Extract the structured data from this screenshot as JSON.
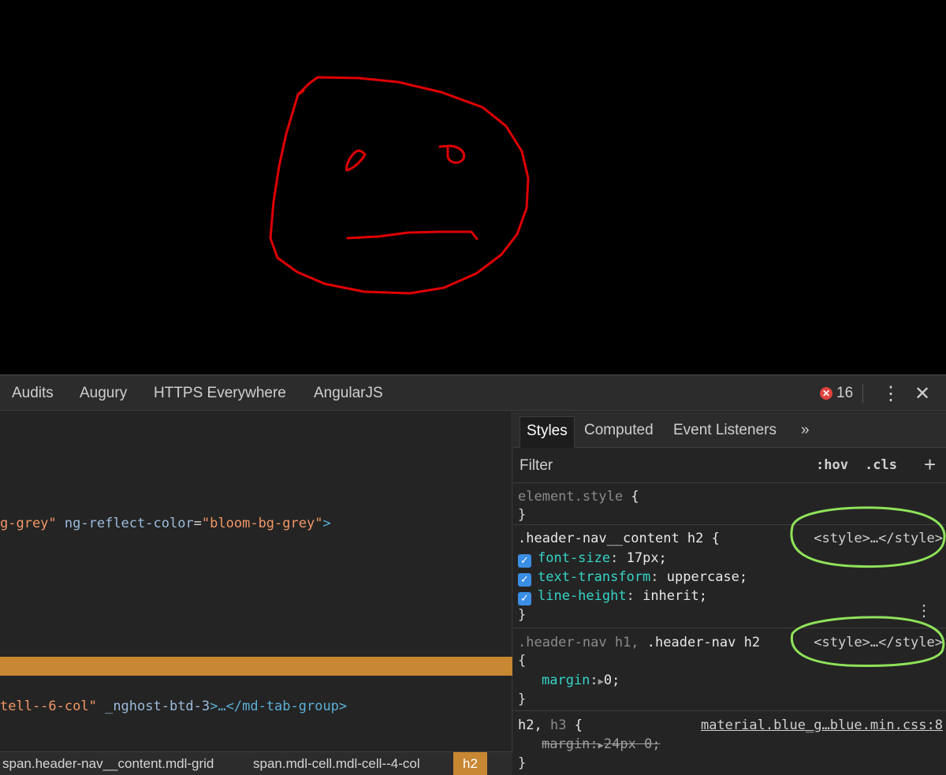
{
  "devtools_tabs": [
    "Audits",
    "Augury",
    "HTTPS Everywhere",
    "AngularJS"
  ],
  "error_count": "16",
  "menu_glyph": "⋮",
  "close_glyph": "✕",
  "elements": {
    "line1": {
      "val_tail": "g-grey\"",
      "attr": "ng-reflect-color",
      "value": "\"bloom-bg-grey\"",
      "close": ">"
    },
    "line2": {
      "val_tail": "tell--6-col\"",
      "attr": "_nghost-btd-3",
      "close_open": ">…",
      "end_tag": "</md-tab-group>"
    }
  },
  "breadcrumb": [
    "span.header-nav__content.mdl-grid",
    "span.mdl-cell.mdl-cell--4-col",
    "h2"
  ],
  "styles_tabs": [
    "Styles",
    "Computed",
    "Event Listeners",
    "»"
  ],
  "filter": {
    "placeholder": "Filter",
    "hov": ":hov",
    "cls": ".cls",
    "add": "+"
  },
  "rules": {
    "element_style": {
      "selector": "element.style",
      "open": "{",
      "close": "}"
    },
    "rule1": {
      "selector": ".header-nav__content h2",
      "open": "{",
      "source": "<style>…</style>",
      "props": [
        {
          "name": "font-size",
          "value": "17px;"
        },
        {
          "name": "text-transform",
          "value": "uppercase;"
        },
        {
          "name": "line-height",
          "value": "inherit;"
        }
      ],
      "close": "}"
    },
    "rule2": {
      "selector_dim": ".header-nav h1,",
      "selector": ".header-nav h2",
      "open": "{",
      "source": "<style>…</style>",
      "prop": "margin",
      "value": "0;",
      "close": "}"
    },
    "rule3": {
      "selector": "h2,",
      "selector_dim": "h3",
      "open": "{",
      "source": "material.blue_g…blue.min.css:8",
      "prop": "margin",
      "value": "24px 0;",
      "close": "}"
    }
  },
  "colors": {
    "drawing": "#e00000",
    "highlight": "#c88733",
    "annotation": "#8fe25a",
    "checkbox": "#3b8ee6"
  }
}
